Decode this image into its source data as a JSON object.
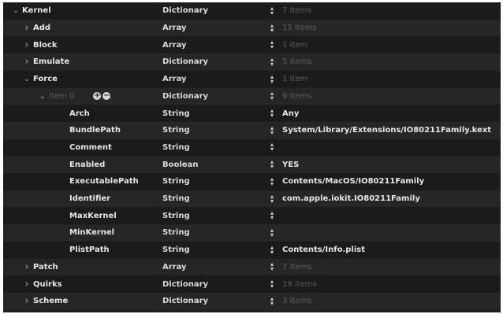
{
  "rows": [
    {
      "key": "Kernel",
      "chevron": "expanded",
      "indent": 0,
      "type": "Dictionary",
      "value": "7 items",
      "value_dim": true
    },
    {
      "key": "Add",
      "chevron": "collapsed",
      "indent": 1,
      "type": "Array",
      "value": "15 items",
      "value_dim": true
    },
    {
      "key": "Block",
      "chevron": "collapsed",
      "indent": 1,
      "type": "Array",
      "value": "1 item",
      "value_dim": true
    },
    {
      "key": "Emulate",
      "chevron": "collapsed",
      "indent": 1,
      "type": "Dictionary",
      "value": "5 items",
      "value_dim": true
    },
    {
      "key": "Force",
      "chevron": "expanded",
      "indent": 1,
      "type": "Array",
      "value": "1 item",
      "value_dim": true
    },
    {
      "key": "Item 0",
      "chevron": "expanded",
      "indent": 2,
      "type": "Dictionary",
      "value": "9 items",
      "value_dim": true,
      "key_dim": true,
      "add_remove": true
    },
    {
      "key": "Arch",
      "chevron": "none",
      "indent": 3,
      "type": "String",
      "value": "Any"
    },
    {
      "key": "BundlePath",
      "chevron": "none",
      "indent": 3,
      "type": "String",
      "value": "System/Library/Extensions/IO80211Family.kext"
    },
    {
      "key": "Comment",
      "chevron": "none",
      "indent": 3,
      "type": "String",
      "value": ""
    },
    {
      "key": "Enabled",
      "chevron": "none",
      "indent": 3,
      "type": "Boolean",
      "value": "YES"
    },
    {
      "key": "ExecutablePath",
      "chevron": "none",
      "indent": 3,
      "type": "String",
      "value": "Contents/MacOS/IO80211Family"
    },
    {
      "key": "Identifier",
      "chevron": "none",
      "indent": 3,
      "type": "String",
      "value": "com.apple.iokit.IO80211Family"
    },
    {
      "key": "MaxKernel",
      "chevron": "none",
      "indent": 3,
      "type": "String",
      "value": ""
    },
    {
      "key": "MinKernel",
      "chevron": "none",
      "indent": 3,
      "type": "String",
      "value": ""
    },
    {
      "key": "PlistPath",
      "chevron": "none",
      "indent": 3,
      "type": "String",
      "value": "Contents/Info.plist"
    },
    {
      "key": "Patch",
      "chevron": "collapsed",
      "indent": 1,
      "type": "Array",
      "value": "7 items",
      "value_dim": true
    },
    {
      "key": "Quirks",
      "chevron": "collapsed",
      "indent": 1,
      "type": "Dictionary",
      "value": "19 items",
      "value_dim": true
    },
    {
      "key": "Scheme",
      "chevron": "collapsed",
      "indent": 1,
      "type": "Dictionary",
      "value": "3 items",
      "value_dim": true
    }
  ],
  "icons": {
    "expanded": "chevron-down-icon",
    "collapsed": "chevron-right-icon",
    "stepper": "stepper-icon",
    "add": "add-icon",
    "remove": "remove-icon"
  },
  "colors": {
    "background": "#1f1f1f",
    "row_alt": "#262626",
    "text": "#e6e6e6",
    "dim_text": "#5e5e5e"
  }
}
